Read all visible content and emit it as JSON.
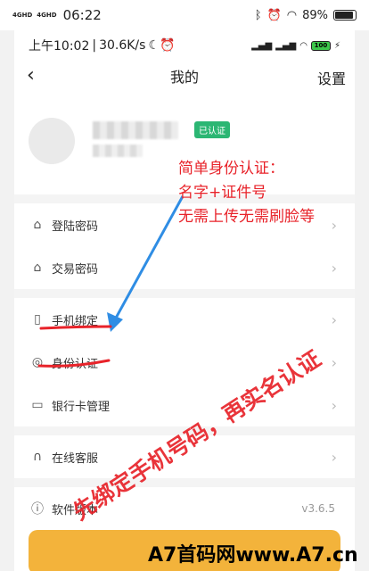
{
  "outer_status": {
    "signal_1": "4GHD",
    "signal_2": "4GHD",
    "time": "06:22",
    "battery": "89%"
  },
  "inner_status": {
    "time": "上午10:02",
    "speed": "30.6K/s",
    "battery": "100"
  },
  "navbar": {
    "back": "‹",
    "title": "我的",
    "settings": "设置"
  },
  "profile": {
    "badge": "已认证"
  },
  "menu": [
    {
      "label": "登陆密码",
      "icon": "lock-icon"
    },
    {
      "label": "交易密码",
      "icon": "lock-icon"
    },
    {
      "label": "手机绑定",
      "icon": "phone-icon"
    },
    {
      "label": "身份认证",
      "icon": "fingerprint-icon"
    },
    {
      "label": "银行卡管理",
      "icon": "card-icon"
    },
    {
      "label": "在线客服",
      "icon": "headset-icon"
    },
    {
      "label": "软件版本",
      "icon": "info-icon",
      "value": "v3.6.5"
    }
  ],
  "annotation": {
    "line1": "简单身份认证：",
    "line2": "名字+证件号",
    "line3": "无需上传无需刷脸等",
    "stamp": "先绑定手机号码，再实名认证"
  },
  "watermark": "A7首码网www.A7.cn",
  "colors": {
    "badge": "#2bb673",
    "annotation": "#e8232a",
    "arrow": "#2f8de4",
    "button": "#f3b33b"
  }
}
